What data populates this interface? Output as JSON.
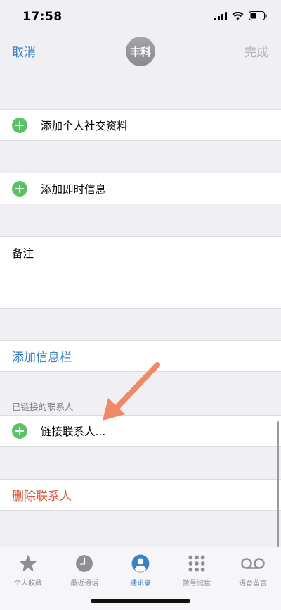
{
  "status": {
    "time": "17:58"
  },
  "nav": {
    "cancel": "取消",
    "avatar_text": "丰科",
    "done": "完成"
  },
  "rows": {
    "add_social": "添加个人社交资料",
    "add_im": "添加即时信息",
    "notes_label": "备注",
    "add_field": "添加信息栏",
    "linked_header": "已链接的联系人",
    "link_contacts": "链接联系人...",
    "delete_contact": "删除联系人"
  },
  "tabbar": {
    "tabs": [
      {
        "label": "个人收藏",
        "icon": "star-icon",
        "active": false
      },
      {
        "label": "最近通话",
        "icon": "clock-icon",
        "active": false
      },
      {
        "label": "通讯录",
        "icon": "person-circle-icon",
        "active": true
      },
      {
        "label": "拨号键盘",
        "icon": "keypad-icon",
        "active": false
      },
      {
        "label": "语音留言",
        "icon": "voicemail-icon",
        "active": false
      }
    ]
  },
  "colors": {
    "accent": "#3b82c4",
    "destructive": "#d3573a",
    "add": "#5cc066",
    "annotation_arrow": "#ee8a67"
  }
}
